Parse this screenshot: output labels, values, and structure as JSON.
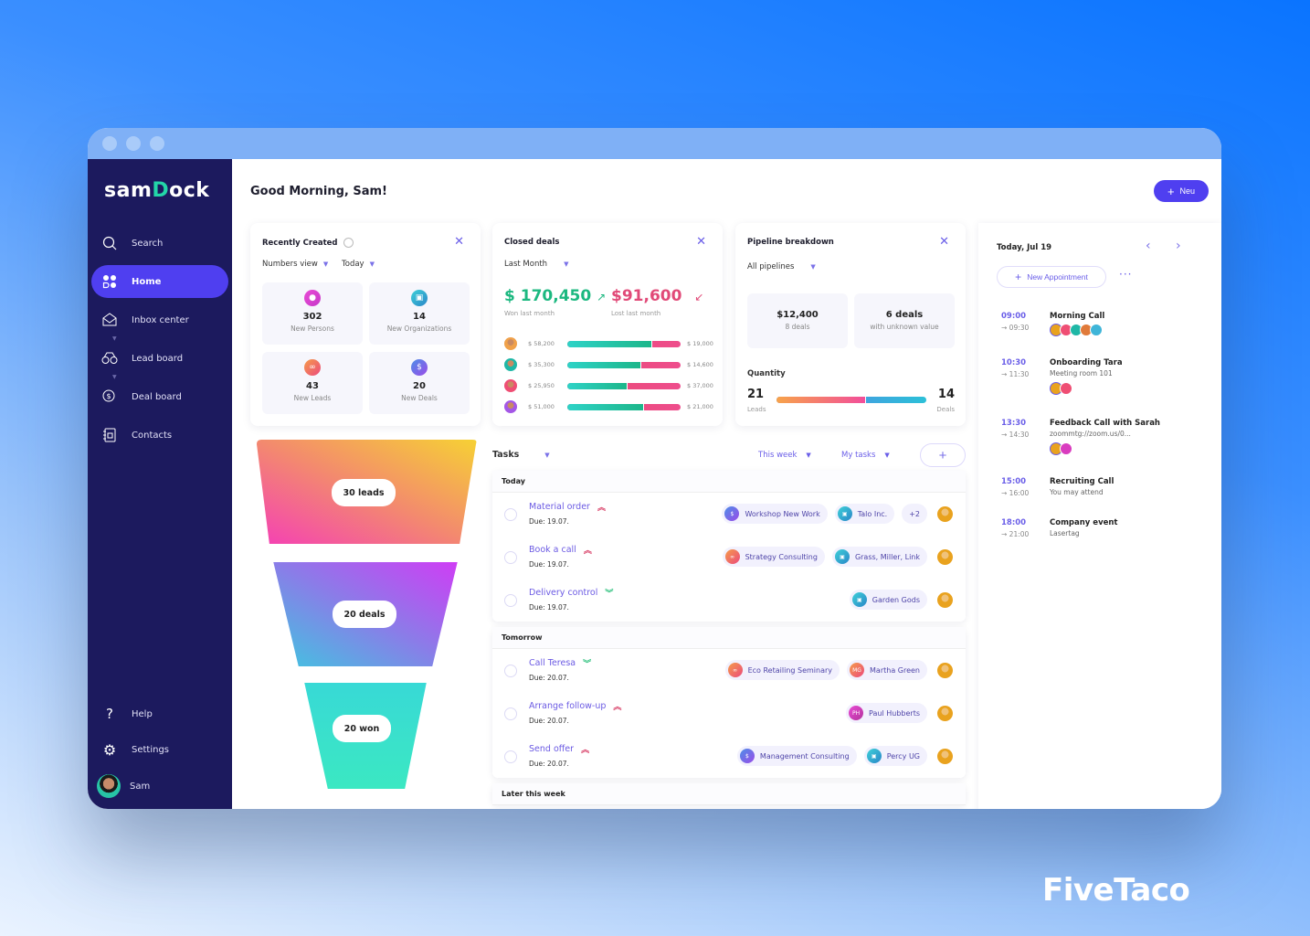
{
  "app": {
    "logo_pre": "sam",
    "logo_o": "D",
    "logo_post": "ock"
  },
  "sidebar": {
    "items": [
      {
        "label": "Search",
        "icon": "search-icon"
      },
      {
        "label": "Home",
        "icon": "home-grid-icon",
        "active": true
      },
      {
        "label": "Inbox center",
        "icon": "envelope-icon"
      },
      {
        "label": "Lead board",
        "icon": "binoculars-icon"
      },
      {
        "label": "Deal board",
        "icon": "dollar-coin-icon"
      },
      {
        "label": "Contacts",
        "icon": "address-book-icon"
      }
    ],
    "bottom": [
      {
        "label": "Help",
        "icon": "question-icon"
      },
      {
        "label": "Settings",
        "icon": "gear-icon"
      },
      {
        "label": "Sam",
        "icon": "user-avatar"
      }
    ]
  },
  "header": {
    "greeting": "Good Morning, Sam!",
    "new_button": "Neu"
  },
  "recently_created": {
    "title": "Recently Created",
    "view_dropdown": "Numbers view",
    "period_dropdown": "Today",
    "tiles": [
      {
        "value": "302",
        "label": "New Persons"
      },
      {
        "value": "14",
        "label": "New Organizations"
      },
      {
        "value": "43",
        "label": "New Leads"
      },
      {
        "value": "20",
        "label": "New Deals"
      }
    ]
  },
  "closed_deals": {
    "title": "Closed deals",
    "period_dropdown": "Last Month",
    "won_value": "$ 170,450",
    "won_label": "Won last month",
    "lost_value": "$91,600",
    "lost_label": "Lost last month",
    "rows": [
      {
        "won": "$ 58,200",
        "lost": "$ 19,000",
        "won_fraction": 0.75
      },
      {
        "won": "$ 35,300",
        "lost": "$ 14,600",
        "won_fraction": 0.65
      },
      {
        "won": "$ 25,950",
        "lost": "$ 37,000",
        "won_fraction": 0.53
      },
      {
        "won": "$ 51,000",
        "lost": "$ 21,000",
        "won_fraction": 0.68
      }
    ]
  },
  "pipeline": {
    "title": "Pipeline breakdown",
    "dropdown": "All pipelines",
    "tile1_value": "$12,400",
    "tile1_label": "8 deals",
    "tile2_value": "6 deals",
    "tile2_label": "with unknown value",
    "quantity_label": "Quantity",
    "leads_value": "21",
    "leads_label": "Leads",
    "deals_value": "14",
    "deals_label": "Deals",
    "leads_fraction": 0.6
  },
  "funnel": [
    {
      "label": "30 leads"
    },
    {
      "label": "20 deals"
    },
    {
      "label": "20 won"
    }
  ],
  "tasks": {
    "title": "Tasks",
    "period": "This week",
    "filter": "My tasks",
    "groups": [
      {
        "name": "Today",
        "items": [
          {
            "title": "Material order",
            "due": "Due: 19.07.",
            "priority": "high",
            "chips": [
              {
                "label": "Workshop New Work",
                "type": "deal"
              },
              {
                "label": "Talo Inc.",
                "type": "org"
              },
              {
                "label": "+2",
                "type": "more"
              }
            ]
          },
          {
            "title": "Book a call",
            "due": "Due: 19.07.",
            "priority": "high",
            "chips": [
              {
                "label": "Strategy Consulting",
                "type": "lead"
              },
              {
                "label": "Grass, Miller, Link",
                "type": "org"
              }
            ]
          },
          {
            "title": "Delivery control",
            "due": "Due: 19.07.",
            "priority": "low",
            "chips": [
              {
                "label": "Garden Gods",
                "type": "org"
              }
            ]
          }
        ]
      },
      {
        "name": "Tomorrow",
        "items": [
          {
            "title": "Call Teresa",
            "due": "Due: 20.07.",
            "priority": "low",
            "chips": [
              {
                "label": "Eco Retailing Seminary",
                "type": "lead"
              },
              {
                "label": "Martha Green",
                "type": "person",
                "initials": "MG"
              }
            ]
          },
          {
            "title": "Arrange follow-up",
            "due": "Due: 20.07.",
            "priority": "high",
            "chips": [
              {
                "label": "Paul Hubberts",
                "type": "person",
                "initials": "PH"
              }
            ]
          },
          {
            "title": "Send offer",
            "due": "Due: 20.07.",
            "priority": "high",
            "chips": [
              {
                "label": "Management Consulting",
                "type": "deal"
              },
              {
                "label": "Percy UG",
                "type": "org"
              }
            ]
          }
        ]
      },
      {
        "name": "Later this week",
        "items": []
      }
    ]
  },
  "calendar": {
    "date": "Today, Jul 19",
    "new_appointment": "New Appointment",
    "events": [
      {
        "start": "09:00",
        "end": "→ 09:30",
        "title": "Morning Call",
        "desc": "",
        "attendees": 5
      },
      {
        "start": "10:30",
        "end": "→ 11:30",
        "title": "Onboarding Tara",
        "desc": "Meeting room 101",
        "attendees": 2
      },
      {
        "start": "13:30",
        "end": "→ 14:30",
        "title": "Feedback Call with Sarah",
        "desc": "zoommtg://zoom.us/0...",
        "attendees": 2
      },
      {
        "start": "15:00",
        "end": "→ 16:00",
        "title": "Recruiting Call",
        "desc": "You may attend",
        "attendees": 0
      },
      {
        "start": "18:00",
        "end": "→ 21:00",
        "title": "Company event",
        "desc": "Lasertag",
        "attendees": 0
      }
    ]
  },
  "watermark": "FiveTaco"
}
